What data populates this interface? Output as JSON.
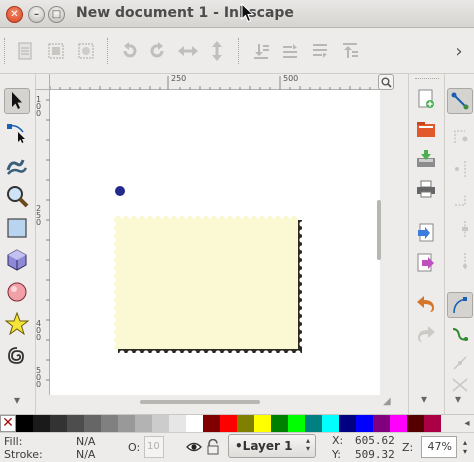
{
  "window": {
    "title": "New document 1 - Inkscape",
    "close_glyph": "✕",
    "minimize_glyph": "–",
    "maximize_glyph": "□"
  },
  "commands_bar": {
    "icons": [
      "document-properties-icon",
      "select-all-icon",
      "select-in-all-layers-icon",
      "rotate-ccw-icon",
      "rotate-cw-icon",
      "flip-horizontal-icon",
      "flip-vertical-icon",
      "lower-to-bottom-icon",
      "lower-icon",
      "raise-icon",
      "raise-to-top-icon"
    ],
    "overflow_glyph": "›"
  },
  "ruler": {
    "h_labels": [
      "250",
      "500"
    ],
    "v_labels": [
      "100",
      "250",
      "400",
      "500"
    ]
  },
  "tools": [
    "selector-tool",
    "node-tool",
    "tweak-tool",
    "zoom-tool",
    "rectangle-tool",
    "3d-box-tool",
    "ellipse-tool",
    "star-tool",
    "spiral-tool"
  ],
  "right_commands": [
    "new-document-icon",
    "open-icon",
    "save-icon",
    "print-icon",
    "import-icon",
    "export-icon",
    "undo-icon",
    "redo-icon"
  ],
  "snap_controls": [
    "enable-snapping-icon",
    "snap-bbox-icon",
    "snap-bbox-edge-icon",
    "snap-bbox-corner-icon",
    "snap-bbox-midpoint-icon",
    "snap-nodes-icon",
    "snap-path-icon",
    "snap-cusp-icon",
    "snap-smooth-icon",
    "snap-intersection-icon"
  ],
  "palette": {
    "no_paint_glyph": "✕",
    "colors": [
      "#000000",
      "#1a1a1a",
      "#333333",
      "#4d4d4d",
      "#666666",
      "#808080",
      "#999999",
      "#b3b3b3",
      "#cccccc",
      "#e6e6e6",
      "#ffffff",
      "#800000",
      "#ff0000",
      "#808000",
      "#ffff00",
      "#008000",
      "#00ff00",
      "#008080",
      "#00ffff",
      "#000080",
      "#0000ff",
      "#800080",
      "#ff00ff",
      "#550000",
      "#aa0044"
    ]
  },
  "status": {
    "fill_label": "Fill:",
    "fill_value": "N/A",
    "stroke_label": "Stroke:",
    "stroke_value": "N/A",
    "opacity_label": "O:",
    "opacity_value": "10",
    "layer_name": "•Layer 1",
    "x_label": "X:",
    "x_value": "605.62",
    "y_label": "Y:",
    "y_value": "509.32",
    "zoom_label": "Z:",
    "zoom_value": "47%"
  },
  "colors": {
    "stamp_fill": "#fbf9d4",
    "dot_color": "#232a8c",
    "canvas_bg": "#ffffff"
  }
}
